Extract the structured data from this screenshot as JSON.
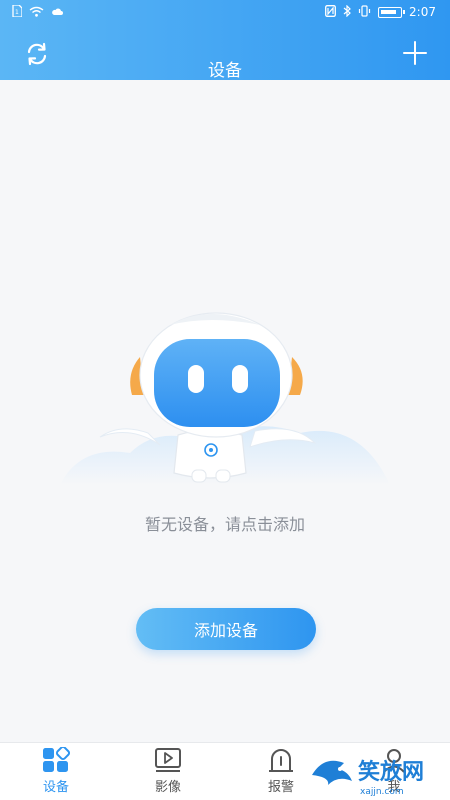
{
  "status_bar": {
    "time": "2:07",
    "battery_label": "(",
    "icons": [
      "sim-icon",
      "wifi-icon",
      "cloud-icon",
      "nfc-icon",
      "bluetooth-icon",
      "vibrate-icon",
      "battery-icon"
    ]
  },
  "header": {
    "title": "设备",
    "refresh_icon": "refresh-icon",
    "add_icon": "plus-icon"
  },
  "empty_state": {
    "message": "暂无设备，请点击添加",
    "add_button_label": "添加设备"
  },
  "tabs": [
    {
      "label": "设备",
      "icon": "device-grid-icon",
      "active": true
    },
    {
      "label": "影像",
      "icon": "play-video-icon",
      "active": false
    },
    {
      "label": "报警",
      "icon": "alarm-icon",
      "active": false
    },
    {
      "label": "我",
      "icon": "user-icon",
      "active": false
    }
  ],
  "watermark": {
    "text": "笑放网",
    "url_text": "xajjn.com"
  },
  "colors": {
    "primary": "#2e95f0",
    "header_light": "#5bb6f5",
    "background": "#f6f7f9",
    "robot_orange": "#f5a94a"
  }
}
